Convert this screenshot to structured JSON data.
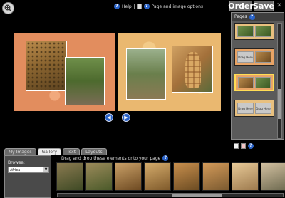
{
  "topbar": {
    "help_label": "Help",
    "page_image_options_label": "Page and image options"
  },
  "actions": {
    "order_label": "Order",
    "save_label": "Save"
  },
  "pages_panel": {
    "title": "Pages",
    "thumb_slot_text": "Drag Here"
  },
  "tabs": [
    {
      "label": "My Images"
    },
    {
      "label": "Gallery"
    },
    {
      "label": "Text"
    },
    {
      "label": "Layouts"
    }
  ],
  "drag_hint": "Drag and drop these elements onto your page",
  "browse": {
    "label": "Browse:",
    "selected": "Africa"
  },
  "icons": {
    "zoom": "zoom-in-icon",
    "help": "question-icon",
    "page_options": "page-options-icon",
    "close": "close-icon",
    "prev": "previous-page-icon",
    "next": "next-page-icon",
    "add_page": "add-page-icon",
    "delete_page": "delete-page-icon"
  },
  "colors": {
    "accent_blue": "#2a63c8",
    "left_page_bg": "#e28d5e",
    "right_page_bg": "#eab870",
    "selected_thumb_border": "#ffdd55"
  }
}
